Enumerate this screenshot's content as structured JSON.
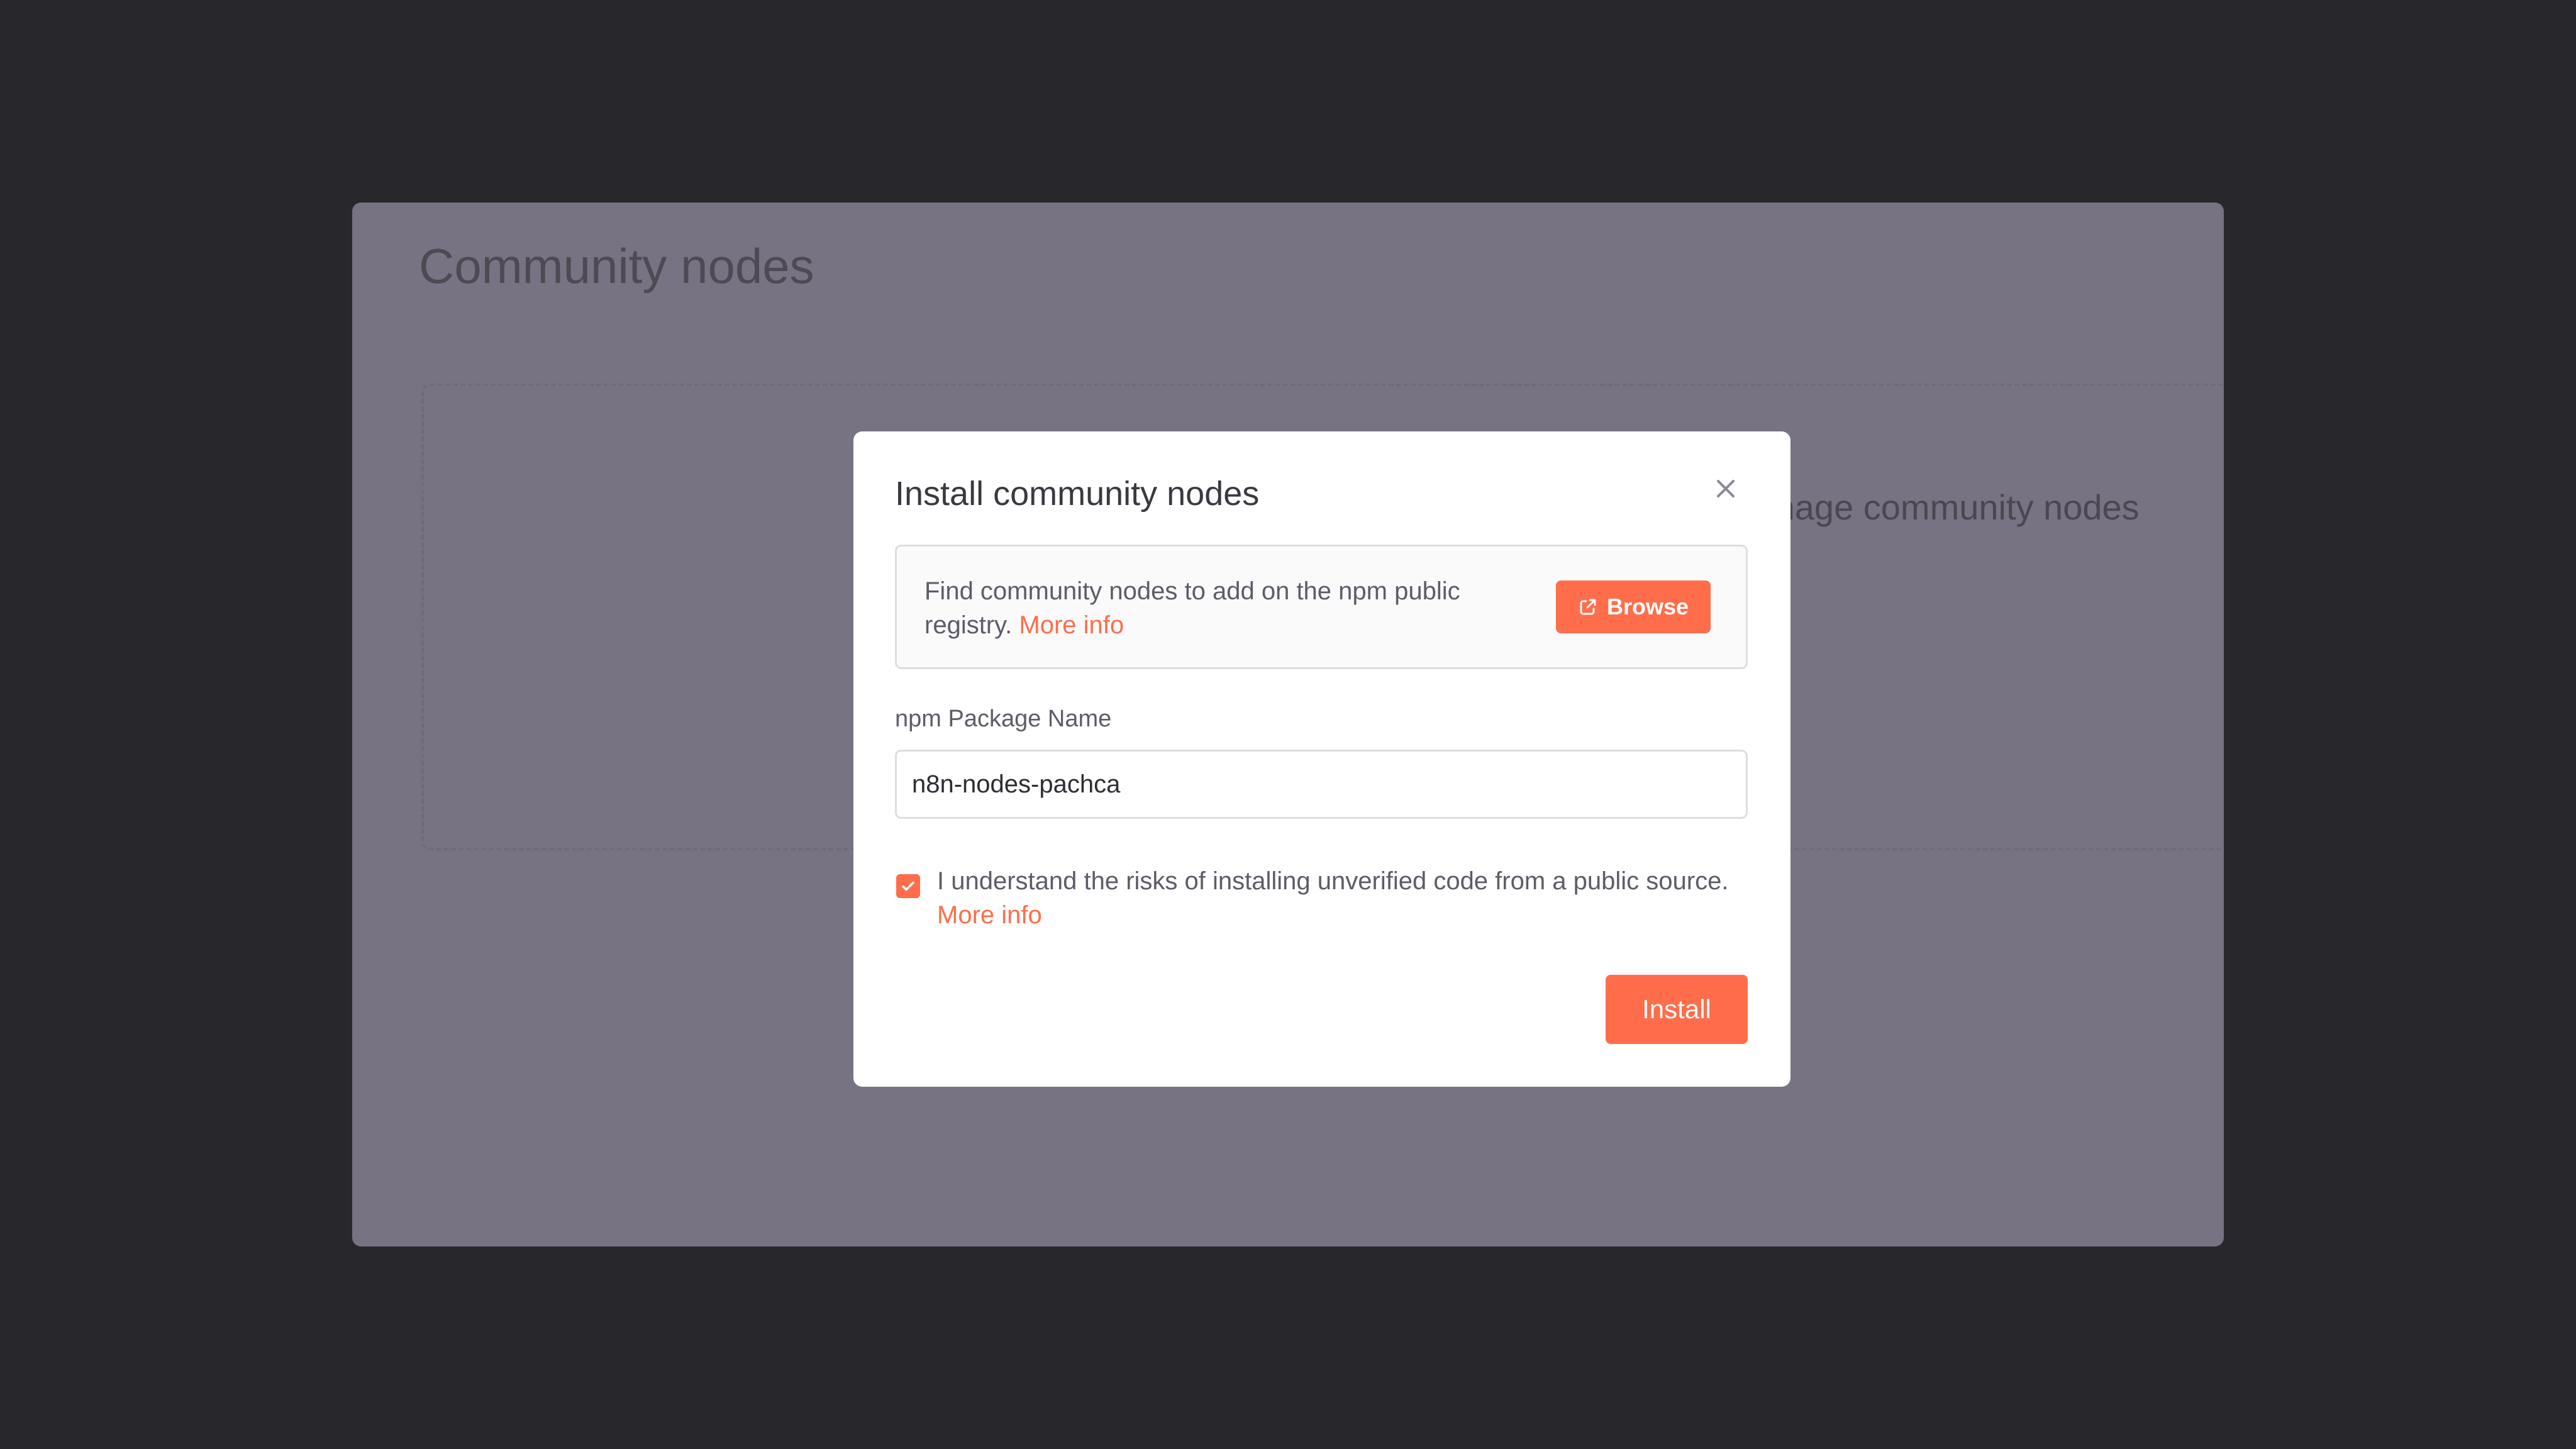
{
  "page": {
    "title": "Community nodes",
    "empty_state_text": "Install and manage community nodes"
  },
  "modal": {
    "title": "Install community nodes",
    "info": {
      "text": "Find community nodes to add on the npm public registry.",
      "more_info": "More info",
      "browse_label": "Browse"
    },
    "package_field": {
      "label": "npm Package Name",
      "value": "n8n-nodes-pachca"
    },
    "risk_checkbox": {
      "checked": true,
      "text": "I understand the risks of installing unverified code from a public source.",
      "more_info": "More info"
    },
    "install_label": "Install"
  },
  "colors": {
    "accent": "#ff6d4a",
    "backdrop": "#28272b",
    "overlay": "#787382"
  },
  "icons": {
    "close": "close-icon",
    "browse": "external-link-icon",
    "checkbox": "check-icon"
  }
}
